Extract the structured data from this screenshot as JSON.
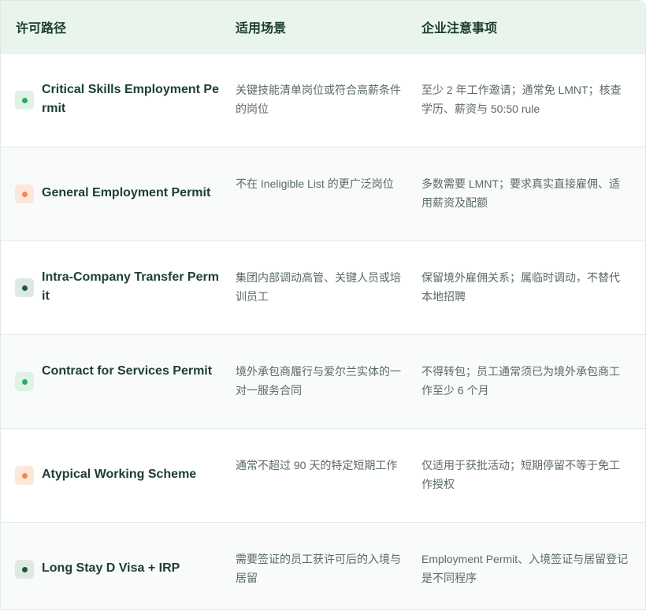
{
  "header": {
    "col1": "许可路径",
    "col2": "适用场景",
    "col3": "企业注意事项"
  },
  "rows": [
    {
      "name": "Critical Skills Employment Permit",
      "scenario": "关键技能清单岗位或符合高薪条件的岗位",
      "notes": "至少 2 年工作邀请；通常免 LMNT；核查学历、薪资与 50:50 rule",
      "dot_color": "#2fa968",
      "dot_bg": "#dff2e6"
    },
    {
      "name": "General Employment Permit",
      "scenario": "不在 Ineligible List 的更广泛岗位",
      "notes": "多数需要 LMNT；要求真实直接雇佣、适用薪资及配额",
      "dot_color": "#f08a4b",
      "dot_bg": "#fde7da"
    },
    {
      "name": "Intra-Company Transfer Permit",
      "scenario": "集团内部调动高管、关键人员或培训员工",
      "notes": "保留境外雇佣关系；属临时调动，不替代本地招聘",
      "dot_color": "#1d5a3c",
      "dot_bg": "#dfe9e3"
    },
    {
      "name": "Contract for Services Permit",
      "scenario": "境外承包商履行与爱尔兰实体的一对一服务合同",
      "notes": "不得转包；员工通常须已为境外承包商工作至少 6 个月",
      "dot_color": "#2fa968",
      "dot_bg": "#dff2e6"
    },
    {
      "name": "Atypical Working Scheme",
      "scenario": "通常不超过 90 天的特定短期工作",
      "notes": "仅适用于获批活动；短期停留不等于免工作授权",
      "dot_color": "#f08a4b",
      "dot_bg": "#fde7da"
    },
    {
      "name": "Long Stay D Visa + IRP",
      "scenario": "需要签证的员工获许可后的入境与居留",
      "notes": "Employment Permit、入境签证与居留登记是不同程序",
      "dot_color": "#1d5a3c",
      "dot_bg": "#dfe9e3"
    }
  ]
}
